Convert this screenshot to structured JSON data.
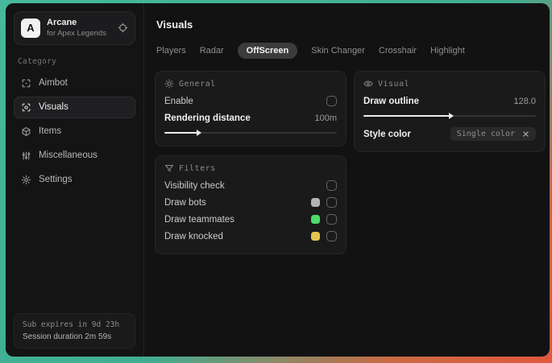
{
  "colors": {
    "desktop_teal": "#42b197",
    "desktop_red": "#e2573d",
    "window_bg": "#121213"
  },
  "sidebar": {
    "logo": {
      "letter": "A",
      "title": "Arcane",
      "subtitle": "for Apex Legends"
    },
    "category_label": "Category",
    "items": [
      {
        "label": "Aimbot",
        "selected": false
      },
      {
        "label": "Visuals",
        "selected": true
      },
      {
        "label": "Items",
        "selected": false
      },
      {
        "label": "Miscellaneous",
        "selected": false
      },
      {
        "label": "Settings",
        "selected": false
      }
    ],
    "footer": {
      "line1": "Sub expires in 9d 23h",
      "line2": "Session duration 2m 59s"
    }
  },
  "header": {
    "title": "Visuals"
  },
  "tabs": [
    {
      "label": "Players",
      "selected": false
    },
    {
      "label": "Radar",
      "selected": false
    },
    {
      "label": "OffScreen",
      "selected": true
    },
    {
      "label": "Skin Changer",
      "selected": false
    },
    {
      "label": "Crosshair",
      "selected": false
    },
    {
      "label": "Highlight",
      "selected": false
    }
  ],
  "panels": {
    "general": {
      "title": "General",
      "enable": {
        "label": "Enable",
        "checked": false
      },
      "rendering": {
        "label": "Rendering distance",
        "value": "100m",
        "percent": 19
      }
    },
    "visual": {
      "title": "Visual",
      "draw_outline": {
        "label": "Draw outline",
        "value": "128.0",
        "percent": 50
      },
      "style_color": {
        "label": "Style color",
        "selected": "Single color"
      }
    },
    "filters": {
      "title": "Filters",
      "rows": [
        {
          "label": "Visibility check",
          "swatch": null,
          "checked": false
        },
        {
          "label": "Draw bots",
          "swatch": "#b3b3b3",
          "checked": false
        },
        {
          "label": "Draw teammates",
          "swatch": "#4fd96a",
          "checked": false
        },
        {
          "label": "Draw knocked",
          "swatch": "#e3c44e",
          "checked": false
        }
      ]
    }
  }
}
